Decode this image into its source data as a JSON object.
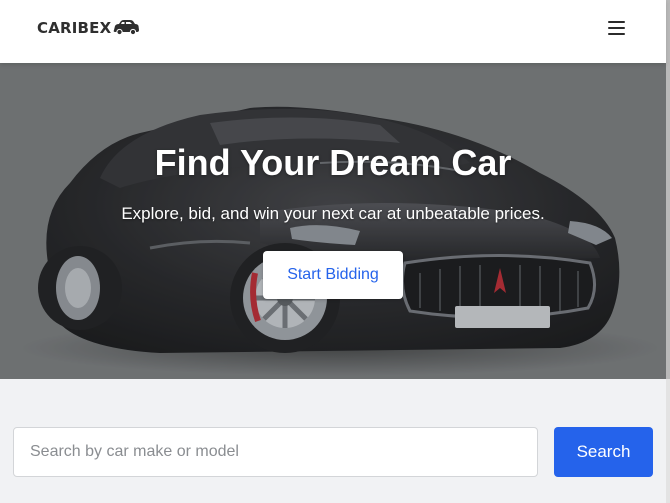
{
  "navbar": {
    "brand": "CARIBEX",
    "logo_icon": "car-icon",
    "menu_icon": "hamburger-menu-icon"
  },
  "hero": {
    "title": "Find Your Dream Car",
    "subtitle": "Explore, bid, and win your next car at unbeatable prices.",
    "cta_label": "Start Bidding",
    "background_icon": "sports-car-photo"
  },
  "search": {
    "placeholder": "Search by car make or model",
    "value": "",
    "button_label": "Search"
  },
  "colors": {
    "accent": "#2563eb",
    "navbar_bg": "#ffffff",
    "page_bg": "#f1f2f4",
    "hero_text": "#ffffff"
  }
}
